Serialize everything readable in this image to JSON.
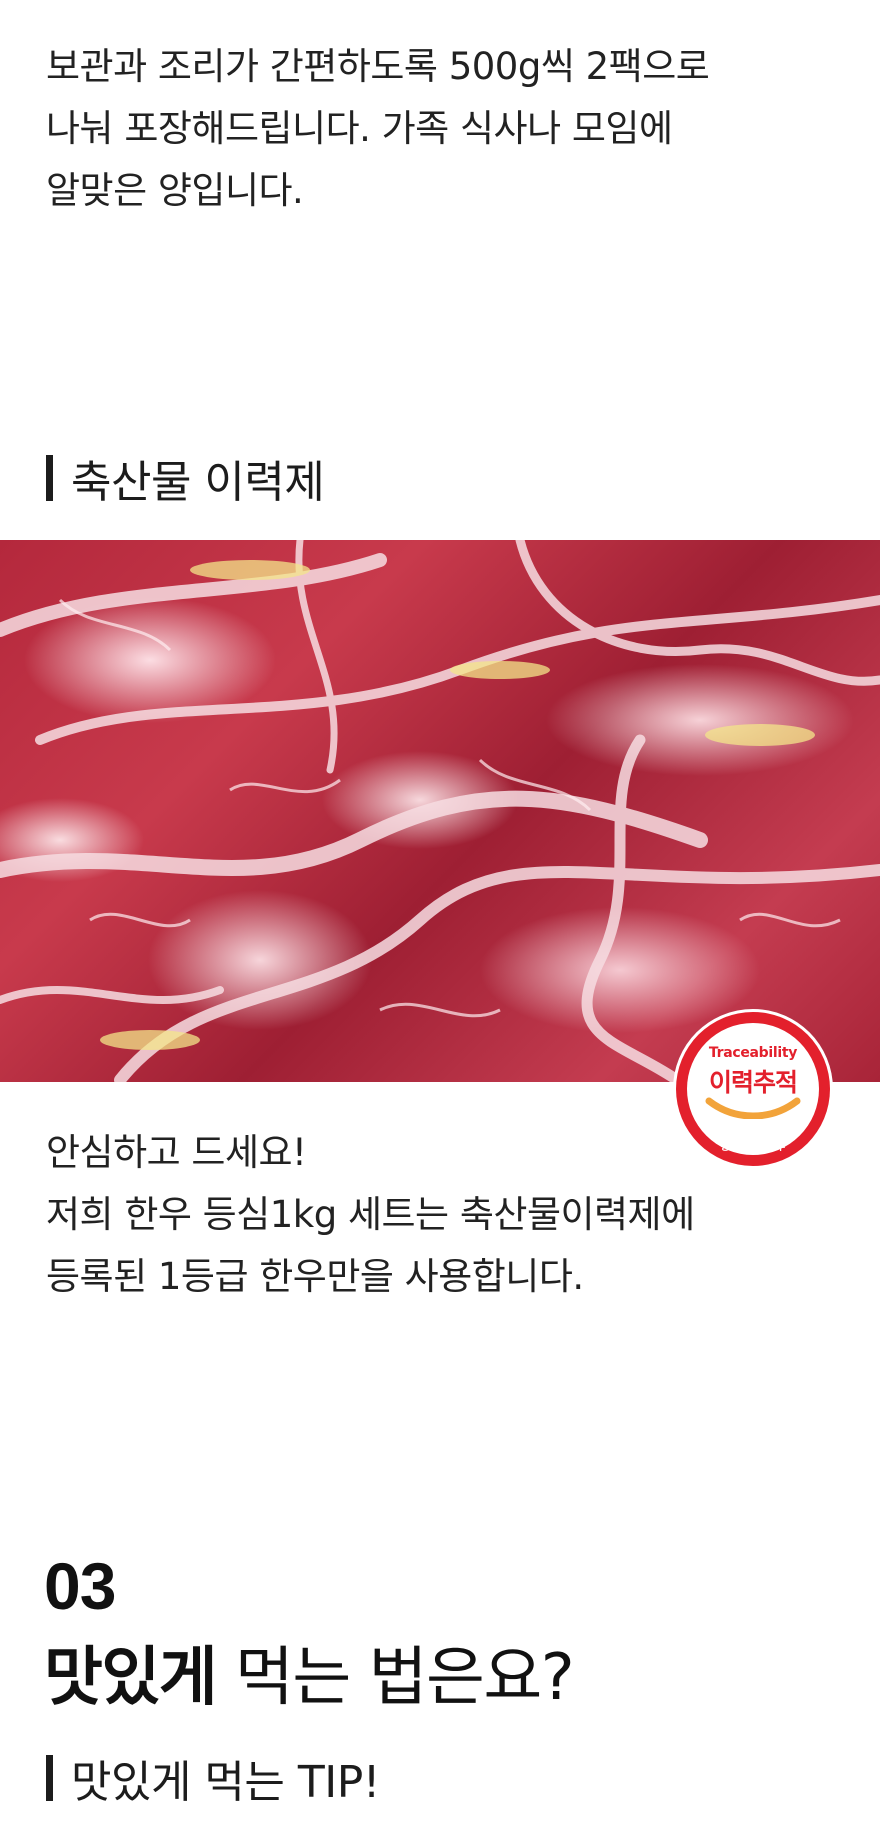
{
  "intro": {
    "lines": [
      "보관과 조리가 간편하도록 500g씩 2팩으로",
      "나눠 포장해드립니다. 가족 식사나 모임에",
      "알맞은 양입니다."
    ]
  },
  "traceability_section": {
    "label": "축산물 이력제",
    "photo_icon": "raw-beef-slices-photo",
    "badge": {
      "english": "Traceability",
      "korean": "이력추적",
      "org": "농림축산식품부",
      "color": "#e3202c",
      "accent": "#f2a33a"
    },
    "lines": [
      "안심하고 드세요!",
      "저희 한우 등심1kg 세트는 축산물이력제에",
      "등록된 1등급 한우만을 사용합니다."
    ]
  },
  "step": {
    "number": "03",
    "title_bold": "맛있게",
    "title_rest": " 먹는 법은요?",
    "tip_label": "맛있게 먹는 TIP!"
  }
}
